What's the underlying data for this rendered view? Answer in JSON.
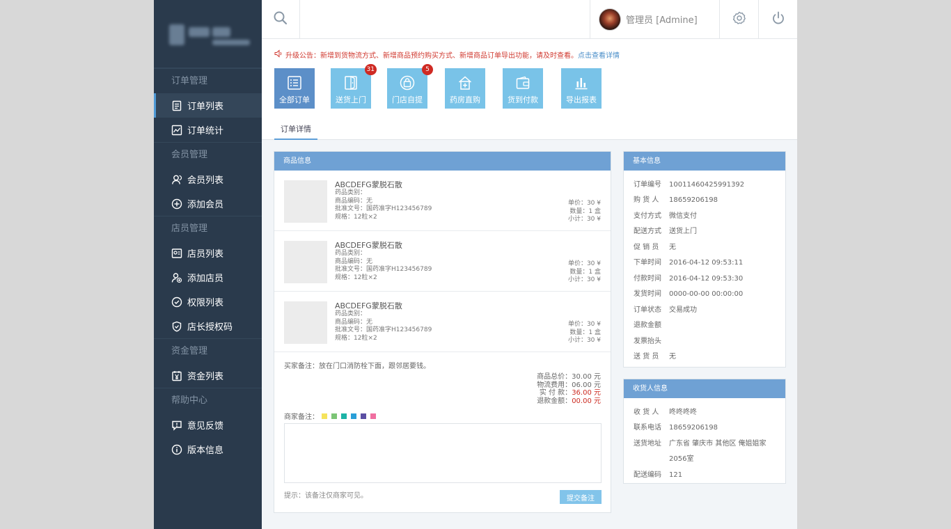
{
  "sidebar": {
    "sections": [
      {
        "title": "订单管理",
        "items": [
          {
            "label": "订单列表"
          },
          {
            "label": "订单统计"
          }
        ]
      },
      {
        "title": "会员管理",
        "items": [
          {
            "label": "会员列表"
          },
          {
            "label": "添加会员"
          }
        ]
      },
      {
        "title": "店员管理",
        "items": [
          {
            "label": "店员列表"
          },
          {
            "label": "添加店员"
          },
          {
            "label": "权限列表"
          },
          {
            "label": "店长授权码"
          }
        ]
      },
      {
        "title": "资金管理",
        "items": [
          {
            "label": "资金列表"
          }
        ]
      },
      {
        "title": "帮助中心",
        "items": [
          {
            "label": "意见反馈"
          },
          {
            "label": "版本信息"
          }
        ]
      }
    ],
    "active_item": "订单列表"
  },
  "header": {
    "user_name": "管理员 [Admine]",
    "icons": {
      "search": "search-icon",
      "settings": "gear-icon",
      "power": "power-icon"
    }
  },
  "notice": {
    "text": "升级公告：新增到货物流方式、新增商品预约购买方式、新增商品订单导出功能，请及时查看。",
    "link": "点击查看详情"
  },
  "tiles": [
    {
      "label": "全部订单",
      "icon": "list-icon"
    },
    {
      "label": "送货上门",
      "icon": "door-icon",
      "badge": "31"
    },
    {
      "label": "门店自提",
      "icon": "bag-icon",
      "badge": "5"
    },
    {
      "label": "药房直购",
      "icon": "pharmacy-icon"
    },
    {
      "label": "货到付款",
      "icon": "wallet-icon"
    },
    {
      "label": "导出报表",
      "icon": "chart-icon"
    }
  ],
  "tabs": {
    "detail": "订单详情"
  },
  "goods": {
    "title": "商品信息",
    "items": [
      {
        "name": "ABCDEFG蒙脱石散",
        "category": "药品类别：",
        "code": "商品编码：无",
        "approval": "批准文号：国药准字H123456789",
        "spec": "规格：12粒×2",
        "unit_price": "单价：30 ¥",
        "qty": "数量：1 盒",
        "subtotal": "小计：30 ¥"
      },
      {
        "name": "ABCDEFG蒙脱石散",
        "category": "药品类别：",
        "code": "商品编码：无",
        "approval": "批准文号：国药准字H123456789",
        "spec": "规格：12粒×2",
        "unit_price": "单价：30 ¥",
        "qty": "数量：1 盒",
        "subtotal": "小计：30 ¥"
      },
      {
        "name": "ABCDEFG蒙脱石散",
        "category": "药品类别：",
        "code": "商品编码：无",
        "approval": "批准文号：国药准字H123456789",
        "spec": "规格：12粒×2",
        "unit_price": "单价：30 ¥",
        "qty": "数量：1 盒",
        "subtotal": "小计：30 ¥"
      }
    ],
    "buyer_note": "买家备注：放在门口消防栓下面，跟邻居要钱。",
    "totals": {
      "goods_total": "商品总价：30.00 元",
      "shipping": "物流费用：06.00 元",
      "paid_label": "实 付 款：",
      "paid_value": "36.00 元",
      "refund_label": "退款金额：",
      "refund_value": "00.00 元"
    },
    "merchant_note_label": "商家备注：",
    "swatches": [
      "#f5e35c",
      "#7cc576",
      "#1db3a6",
      "#2a9fd8",
      "#5b4fa3",
      "#f06fa0"
    ],
    "remark_value": "",
    "hint": "提示：该备注仅商家可见。",
    "submit": "提交备注"
  },
  "basic": {
    "title": "基本信息",
    "rows": [
      {
        "k": "订单编号",
        "v": "10011460425991392"
      },
      {
        "k": "购 货 人",
        "v": "18659206198"
      },
      {
        "k": "支付方式",
        "v": "微信支付"
      },
      {
        "k": "配送方式",
        "v": "送货上门"
      },
      {
        "k": "促 销 员",
        "v": "无"
      },
      {
        "k": "下单时间",
        "v": "2016-04-12 09:53:11"
      },
      {
        "k": "付款时间",
        "v": "2016-04-12 09:53:30"
      },
      {
        "k": "发货时间",
        "v": "0000-00-00 00:00:00"
      },
      {
        "k": "订单状态",
        "v": "交易成功"
      },
      {
        "k": "退款金额",
        "v": ""
      },
      {
        "k": "发票抬头",
        "v": ""
      },
      {
        "k": "送 货 员",
        "v": "无"
      }
    ]
  },
  "receiver": {
    "title": "收货人信息",
    "rows": [
      {
        "k": "收 货 人",
        "v": "咚咚咚咚"
      },
      {
        "k": "联系电话",
        "v": "18659206198"
      },
      {
        "k": "送货地址",
        "v": "广东省 肇庆市 其他区 俺姐姐家"
      },
      {
        "k": "",
        "v": "2056室"
      },
      {
        "k": "配送编码",
        "v": "121"
      }
    ]
  },
  "colors": {
    "sidebar": "#2a3a4c",
    "accent": "#6fa1d4",
    "tile": "#79c3e8",
    "badge": "#cf2a23",
    "notice": "#d03a30"
  }
}
